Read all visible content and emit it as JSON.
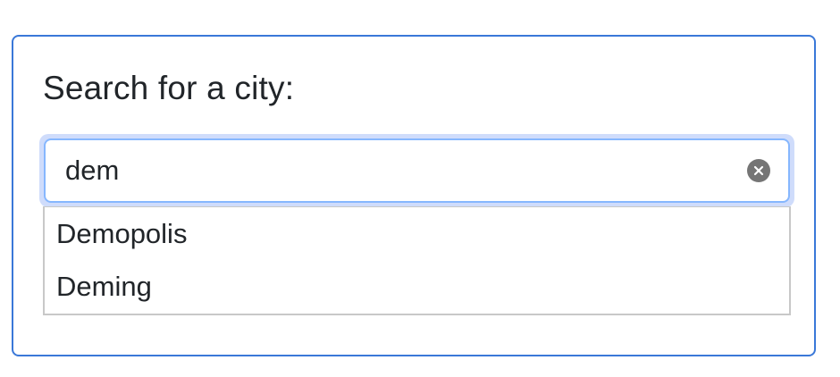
{
  "search": {
    "label": "Search for a city:",
    "value": "dem",
    "clear_icon": "close-circle-icon"
  },
  "suggestions": [
    {
      "label": "Demopolis"
    },
    {
      "label": "Deming"
    }
  ],
  "colors": {
    "card_border": "#3a78d8",
    "focus_ring": "#cfdcfb",
    "input_border": "#86b7fe",
    "clear_icon_bg": "#757575",
    "list_border": "#c8c8c8",
    "text": "#212529"
  }
}
